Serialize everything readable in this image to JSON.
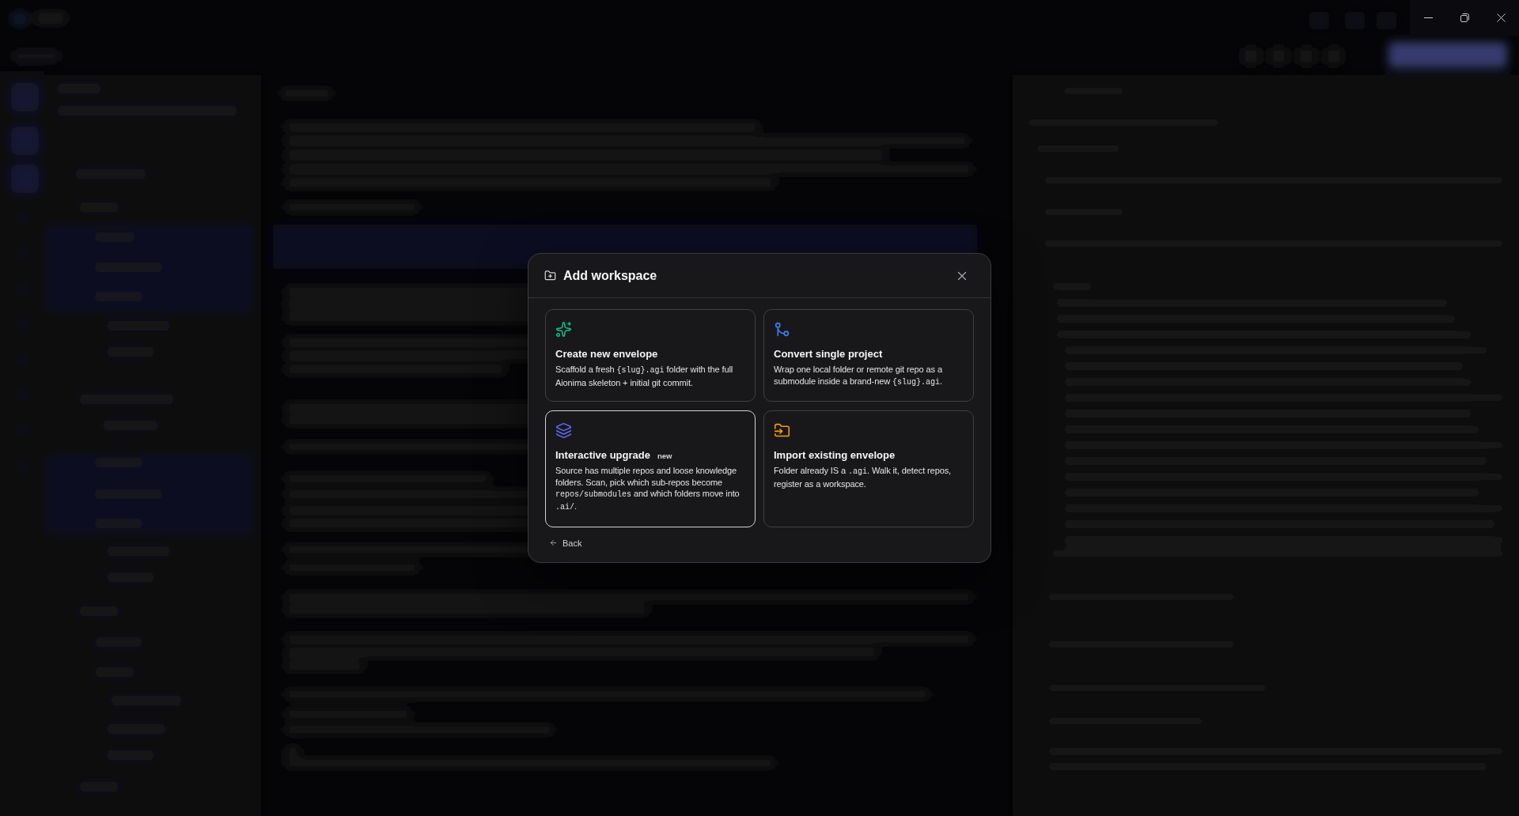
{
  "dialog": {
    "title": "Add workspace",
    "cards": [
      {
        "kind": "create",
        "color": "#10b981",
        "title": "Create new envelope",
        "selected": false,
        "description": [
          {
            "kind": "text",
            "text": "Scaffold a fresh "
          },
          {
            "kind": "code",
            "text": "{slug}.agi"
          },
          {
            "kind": "text",
            "text": " folder with the full Aionima skeleton + initial git commit."
          }
        ]
      },
      {
        "kind": "convert",
        "color": "#3b82f6",
        "title": "Convert single project",
        "selected": false,
        "description": [
          {
            "kind": "text",
            "text": "Wrap one local folder or remote git repo as a submodule inside a brand-new "
          },
          {
            "kind": "code",
            "text": "{slug}.agi"
          },
          {
            "kind": "text",
            "text": "."
          }
        ]
      },
      {
        "kind": "upgrade",
        "color": "#6366f1",
        "title": "Interactive upgrade",
        "badge": "new",
        "selected": true,
        "description": [
          {
            "kind": "text",
            "text": "Source has multiple repos and loose knowledge folders. Scan, pick which sub-repos become "
          },
          {
            "kind": "code",
            "text": "repos/submodules"
          },
          {
            "kind": "text",
            "text": " and which folders move into "
          },
          {
            "kind": "code",
            "text": ".ai/"
          },
          {
            "kind": "text",
            "text": "."
          }
        ]
      },
      {
        "kind": "import",
        "color": "#f59e0b",
        "title": "Import existing envelope",
        "selected": false,
        "description": [
          {
            "kind": "text",
            "text": "Folder already IS a "
          },
          {
            "kind": "code",
            "text": ".agi"
          },
          {
            "kind": "text",
            "text": ". Walk it, detect repos, register as a workspace."
          }
        ]
      }
    ],
    "back_label": "Back"
  }
}
